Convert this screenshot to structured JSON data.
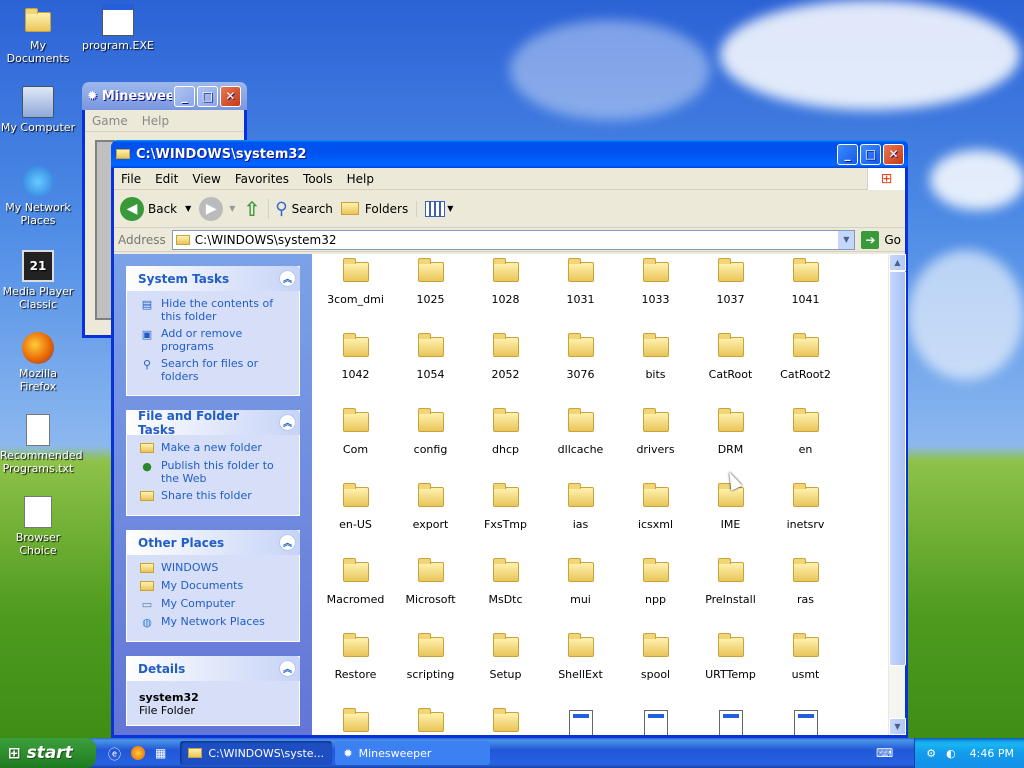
{
  "desktop": {
    "icons": [
      {
        "label": "My Documents",
        "icon": "my-documents-icon"
      },
      {
        "label": "program.EXE",
        "icon": "program-exe-icon"
      },
      {
        "label": "My Computer",
        "icon": "my-computer-icon"
      },
      {
        "label": "My Network Places",
        "icon": "network-places-icon"
      },
      {
        "label": "Media Player Classic",
        "icon": "media-player-icon"
      },
      {
        "label": "Mozilla Firefox",
        "icon": "firefox-icon"
      },
      {
        "label": "Recommended Programs.txt",
        "icon": "text-file-icon"
      },
      {
        "label": "Browser Choice",
        "icon": "browser-choice-icon"
      }
    ]
  },
  "minesweeper": {
    "title": "Minesweeper",
    "title_shown": "Minesweeper",
    "menu": [
      "Game",
      "Help"
    ]
  },
  "explorer": {
    "title": "C:\\WINDOWS\\system32",
    "menu": [
      "File",
      "Edit",
      "View",
      "Favorites",
      "Tools",
      "Help"
    ],
    "toolbar": {
      "back": "Back",
      "search": "Search",
      "folders": "Folders"
    },
    "address": {
      "label": "Address",
      "value": "C:\\WINDOWS\\system32",
      "go": "Go"
    },
    "system_tasks": {
      "title": "System Tasks",
      "items": [
        "Hide the contents of this folder",
        "Add or remove programs",
        "Search for files or folders"
      ]
    },
    "file_folder_tasks": {
      "title": "File and Folder Tasks",
      "items": [
        "Make a new folder",
        "Publish this folder to the Web",
        "Share this folder"
      ]
    },
    "other_places": {
      "title": "Other Places",
      "items": [
        "WINDOWS",
        "My Documents",
        "My Computer",
        "My Network Places"
      ]
    },
    "details": {
      "title": "Details",
      "name": "system32",
      "type": "File Folder"
    },
    "items": [
      "3com_dmi",
      "1025",
      "1028",
      "1031",
      "1033",
      "1037",
      "1041",
      "1042",
      "1054",
      "2052",
      "3076",
      "bits",
      "CatRoot",
      "CatRoot2",
      "Com",
      "config",
      "dhcp",
      "dllcache",
      "drivers",
      "DRM",
      "en",
      "en-US",
      "export",
      "FxsTmp",
      "ias",
      "icsxml",
      "IME",
      "inetsrv",
      "Macromed",
      "Microsoft",
      "MsDtc",
      "mui",
      "npp",
      "PreInstall",
      "ras",
      "Restore",
      "scripting",
      "Setup",
      "ShellExt",
      "spool",
      "URTTemp",
      "usmt"
    ]
  },
  "taskbar": {
    "start": "start",
    "tasks": [
      "C:\\WINDOWS\\syste...",
      "Minesweeper"
    ],
    "clock": "4:46 PM"
  },
  "colors": {
    "xp_blue": "#0053ee",
    "link_blue": "#215dc6",
    "start_green": "#2b8b2b"
  }
}
